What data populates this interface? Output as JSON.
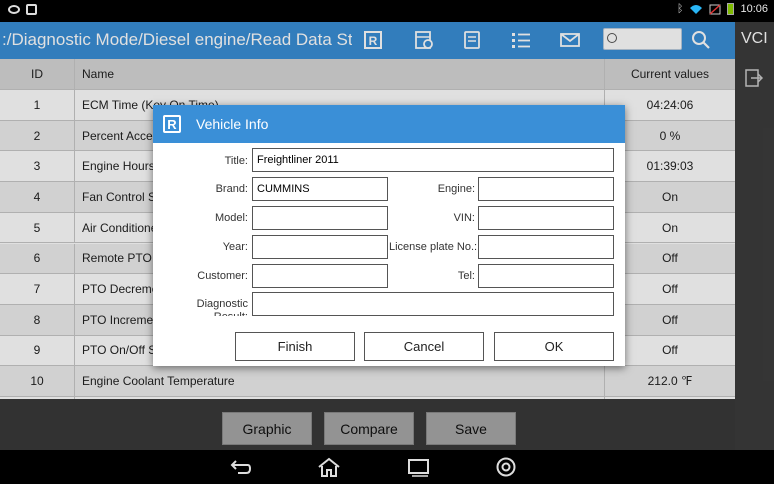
{
  "status_bar": {
    "time": "10:06"
  },
  "title_bar": {
    "path": ":/Diagnostic Mode/Diesel engine/Read Data Stream",
    "search_value": "",
    "vci_label": "VCI"
  },
  "table": {
    "headers": {
      "id": "ID",
      "name": "Name",
      "value": "Current values"
    },
    "rows": [
      {
        "id": "1",
        "name": "ECM Time (Key On Time)",
        "value": "04:24:06"
      },
      {
        "id": "2",
        "name": "Percent Accelerator Pedal",
        "value": "0 %"
      },
      {
        "id": "3",
        "name": "Engine Hours",
        "value": "01:39:03"
      },
      {
        "id": "4",
        "name": "Fan Control Status",
        "value": "On"
      },
      {
        "id": "5",
        "name": "Air Conditioner Pressure Switch",
        "value": "On"
      },
      {
        "id": "6",
        "name": "Remote PTO Switch",
        "value": "Off"
      },
      {
        "id": "7",
        "name": "PTO Decrement Switch",
        "value": "Off"
      },
      {
        "id": "8",
        "name": "PTO Increment Switch",
        "value": "Off"
      },
      {
        "id": "9",
        "name": "PTO On/Off Switch",
        "value": "Off"
      },
      {
        "id": "10",
        "name": "Engine Coolant Temperature",
        "value": "212.0 ℉"
      },
      {
        "id": "",
        "name": "",
        "value": ""
      }
    ]
  },
  "action_bar": {
    "graphic": "Graphic",
    "compare": "Compare",
    "save": "Save"
  },
  "dialog": {
    "logo": "R",
    "title": "Vehicle Info",
    "fields": {
      "title_label": "Title:",
      "title_value": "Freightliner 2011",
      "brand_label": "Brand:",
      "brand_value": "CUMMINS",
      "engine_label": "Engine:",
      "engine_value": "",
      "model_label": "Model:",
      "model_value": "",
      "vin_label": "VIN:",
      "vin_value": "",
      "year_label": "Year:",
      "year_value": "",
      "plate_label": "License plate No.:",
      "plate_value": "",
      "customer_label": "Customer:",
      "customer_value": "",
      "tel_label": "Tel:",
      "tel_value": "",
      "result_label": "Diagnostic Result:",
      "result_value": ""
    },
    "buttons": {
      "finish": "Finish",
      "cancel": "Cancel",
      "ok": "OK"
    }
  },
  "colors": {
    "accent": "#3a8fd7",
    "panel_dark": "#3c3c3c"
  }
}
